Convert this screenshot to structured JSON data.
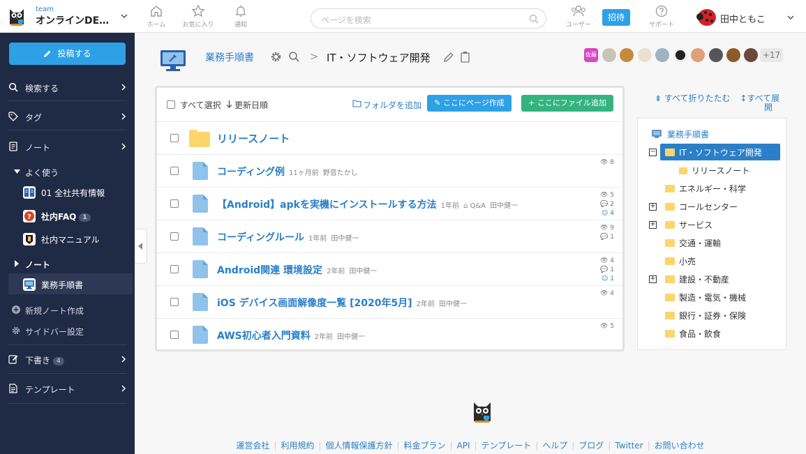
{
  "header": {
    "team_small": "team",
    "team_name": "オンラインDE…",
    "nav": [
      {
        "label": "ホーム",
        "icon": "home-icon"
      },
      {
        "label": "お気に入り",
        "icon": "star-icon"
      },
      {
        "label": "通知",
        "icon": "bell-icon"
      }
    ],
    "search_placeholder": "ページを検索",
    "users_label": "ユーザー",
    "invite_label": "招待",
    "support_label": "サポート",
    "user_name": "田中ともこ"
  },
  "sidebar": {
    "post_button": "投稿する",
    "menu": [
      {
        "label": "検索する",
        "icon": "search-icon"
      },
      {
        "label": "タグ",
        "icon": "tag-icon"
      },
      {
        "label": "ノート",
        "icon": "note-icon"
      }
    ],
    "favorites_heading": "よく使う",
    "favorites": [
      {
        "label": "01 全社共有情報"
      },
      {
        "label": "社内FAQ",
        "badge": "1"
      },
      {
        "label": "社内マニュアル"
      }
    ],
    "notes_heading": "ノート",
    "notes": [
      {
        "label": "業務手順書"
      }
    ],
    "new_note": "新規ノート作成",
    "sidebar_settings": "サイドバー設定",
    "drafts": {
      "label": "下書き",
      "badge": "4"
    },
    "templates": "テンプレート"
  },
  "note_header": {
    "note_title": "業務手順書",
    "breadcrumb_separator": ">",
    "current_folder": "IT・ソフトウェア開発",
    "member_label": "佐藤",
    "more_members": "+17"
  },
  "list": {
    "select_all": "すべて選択",
    "sort_label": "更新日順",
    "add_folder": "フォルダを追加",
    "create_page": "ここにページ作成",
    "add_file": "ここにファイル追加",
    "folder": {
      "name": "リリースノート"
    },
    "pages": [
      {
        "title": "コーディング例",
        "time": "11ヶ月前",
        "author": "野音たかし",
        "tag": "",
        "views": "8",
        "comments": "",
        "reactions": ""
      },
      {
        "title": "【Android】apkを実機にインストールする方法",
        "time": "1年前",
        "author": "田中健一",
        "tag": "Q&A",
        "views": "5",
        "comments": "2",
        "reactions": "4"
      },
      {
        "title": "コーディングルール",
        "time": "1年前",
        "author": "田中健一",
        "tag": "",
        "views": "9",
        "comments": "1",
        "reactions": ""
      },
      {
        "title": "Android関連 環境設定",
        "time": "2年前",
        "author": "田中健一",
        "tag": "",
        "views": "4",
        "comments": "1",
        "reactions": "1"
      },
      {
        "title": "iOS デバイス画面解像度一覧 [2020年5月]",
        "time": "2年前",
        "author": "田中健一",
        "tag": "",
        "views": "4",
        "comments": "",
        "reactions": ""
      },
      {
        "title": "AWS初心者入門資料",
        "time": "2年前",
        "author": "田中健一",
        "tag": "",
        "views": "5",
        "comments": "",
        "reactions": ""
      }
    ]
  },
  "tree": {
    "collapse_all": "すべて折りたたむ",
    "expand_all_1": "すべて展",
    "expand_all_2": "開",
    "root": "業務手順書",
    "items": [
      {
        "label": "IT・ソフトウェア開発",
        "selected": true,
        "toggle": "minus"
      },
      {
        "label": "リリースノート",
        "child": true
      },
      {
        "label": "エネルギー・科学"
      },
      {
        "label": "コールセンター",
        "toggle": "plus"
      },
      {
        "label": "サービス",
        "toggle": "plus"
      },
      {
        "label": "交通・運輸"
      },
      {
        "label": "小売"
      },
      {
        "label": "建設・不動産",
        "toggle": "plus"
      },
      {
        "label": "製造・電気・機械"
      },
      {
        "label": "銀行・証券・保険"
      },
      {
        "label": "食品・飲食"
      }
    ]
  },
  "footer": {
    "links": [
      "運営会社",
      "利用規約",
      "個人情報保護方針",
      "料金プラン",
      "API",
      "テンプレート",
      "ヘルプ",
      "ブログ",
      "Twitter",
      "お問い合わせ"
    ]
  },
  "colors": {
    "accent": "#2ea0e6",
    "link": "#2a7fc7",
    "sidebar_bg": "#1f2a44",
    "green": "#35b37e",
    "folder": "#fcd56b"
  }
}
